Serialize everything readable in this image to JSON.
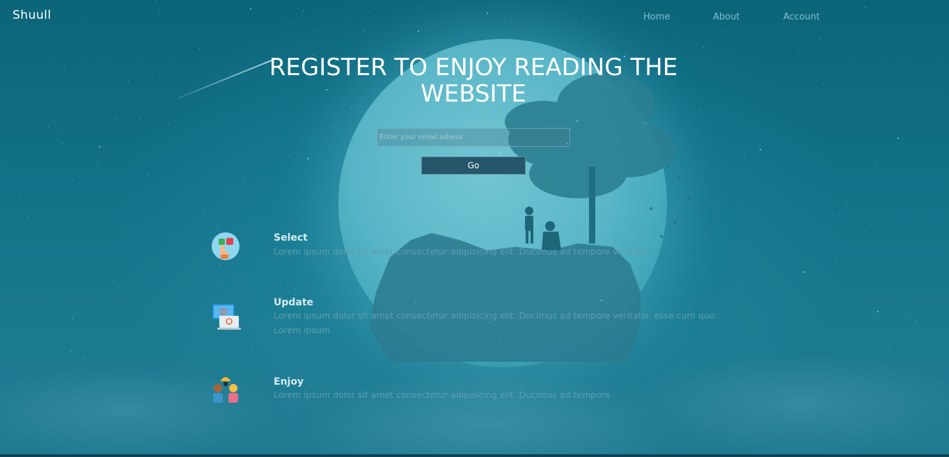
{
  "header": {
    "brand": "Shuull",
    "nav": [
      {
        "label": "Home"
      },
      {
        "label": "About"
      },
      {
        "label": "Account"
      }
    ]
  },
  "hero": {
    "title": "REGISTER TO ENJOY READING THE WEBSITE",
    "email_placeholder": "Enter your email adress",
    "email_value": "",
    "button_label": "Go"
  },
  "features": [
    {
      "icon": "hand-select-icon",
      "title": "Select",
      "text": "Lorem ipsum dolor sit amet consectetur adipisicing elit. Ducimus ad tempore veritatis"
    },
    {
      "icon": "computer-update-icon",
      "title": "Update",
      "text": "Lorem ipsum dolor sit amet consectetur adipisicing elit. Ducimus ad tempore veritatis, esse cum quo. Lorem ipsum"
    },
    {
      "icon": "people-enjoy-icon",
      "title": "Enjoy",
      "text": "Lorem ipsum dolor sit amet consectetur adipisicing elit. Ducimus ad tempore"
    }
  ],
  "colors": {
    "background": "#0f6a80",
    "moon": "#5ab7c8",
    "button": "#25566a",
    "nav_text": "#7fc0cf",
    "feature_text": "#5f9eb0"
  }
}
